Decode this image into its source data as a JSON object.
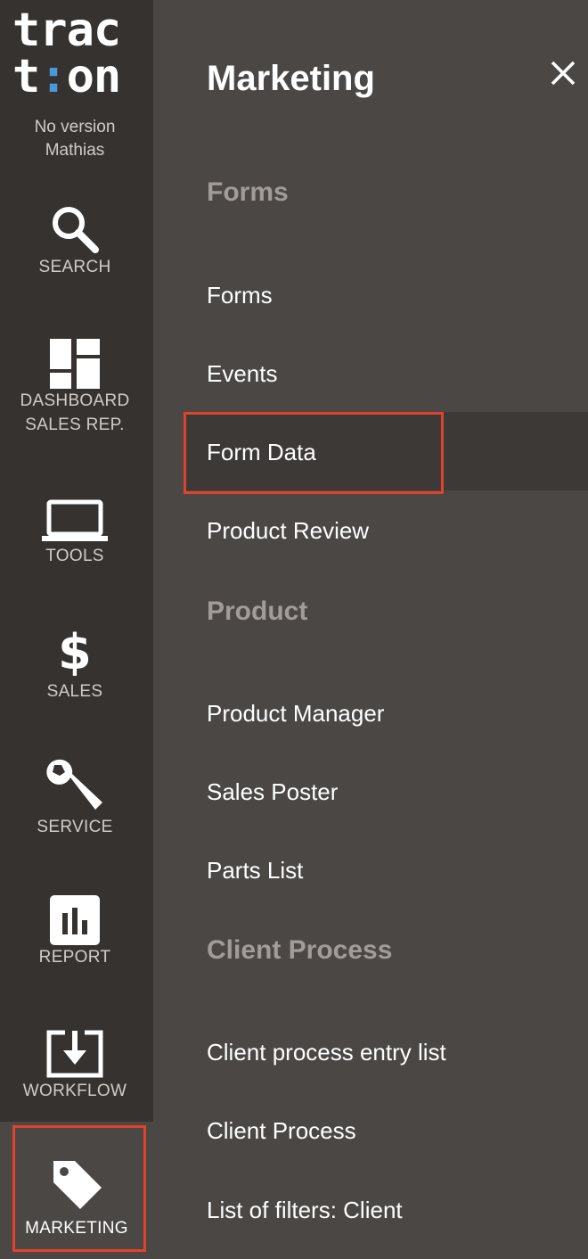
{
  "app": {
    "logo_line1": "trac",
    "logo_line2_a": "t",
    "logo_line2_b": ":",
    "logo_line2_c": "on",
    "version": "No version",
    "user": "Mathias"
  },
  "sidebar": {
    "items": [
      {
        "label": "SEARCH",
        "icon": "search-icon"
      },
      {
        "label": "DASHBOARD\nSALES REP.",
        "icon": "dashboard-icon"
      },
      {
        "label": "TOOLS",
        "icon": "laptop-icon"
      },
      {
        "label": "SALES",
        "icon": "dollar-icon"
      },
      {
        "label": "SERVICE",
        "icon": "wrench-icon"
      },
      {
        "label": "REPORT",
        "icon": "bar-chart-icon"
      },
      {
        "label": "WORKFLOW",
        "icon": "download-tray-icon"
      },
      {
        "label": "MARKETING",
        "icon": "tag-icon",
        "active": true
      }
    ]
  },
  "panel": {
    "title": "Marketing",
    "close_icon": "close-icon",
    "sections": [
      {
        "heading": "Forms",
        "items": [
          "Forms",
          "Events",
          "Form Data",
          "Product Review"
        ]
      },
      {
        "heading": "Product",
        "items": [
          "Product Manager",
          "Sales Poster",
          "Parts List"
        ]
      },
      {
        "heading": "Client Process",
        "items": [
          "Client process entry list",
          "Client Process",
          "List of filters: Client"
        ]
      }
    ],
    "active_item": "Form Data"
  },
  "colors": {
    "sidebar_bg": "#353230",
    "panel_bg": "#4a4745",
    "highlight": "#e0432b",
    "section_heading": "#a19c97",
    "logo_accent": "#4a98d8"
  }
}
